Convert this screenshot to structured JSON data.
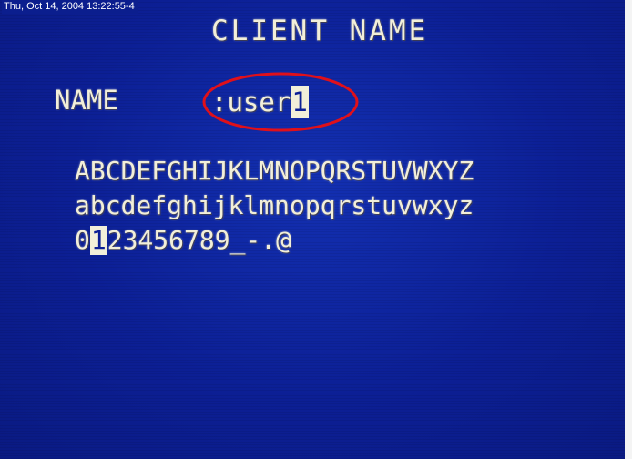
{
  "timestamp": "Thu, Oct 14, 2004 13:22:55-4",
  "title": "CLIENT NAME",
  "name_field": {
    "label": "NAME",
    "prefix": ":",
    "value": "user",
    "cursor_char": "1"
  },
  "character_set": {
    "uppercase": "ABCDEFGHIJKLMNOPQRSTUVWXYZ",
    "lowercase": "abcdefghijklmnopqrstuvwxyz",
    "digits_before_selection": "0",
    "selected_char": "1",
    "digits_after_selection": "23456789_-.@"
  },
  "colors": {
    "screen_background": "#0c1f95",
    "osd_text": "#f2efd9",
    "highlight_ellipse": "#e0101a"
  }
}
